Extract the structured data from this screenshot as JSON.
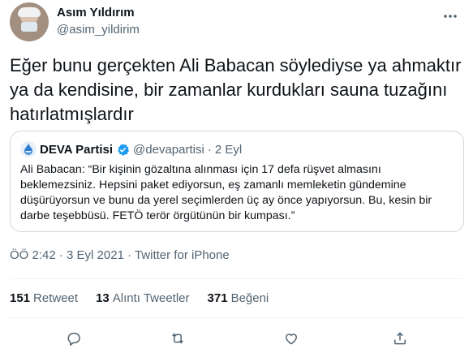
{
  "author": {
    "name": "Asım Yıldırım",
    "handle": "@asim_yildirim"
  },
  "tweet": {
    "text": "Eğer bunu gerçekten Ali Babacan söylediyse ya ahmaktır ya da kendisine, bir zamanlar kurdukları sauna tuzağını hatırlatmışlardır"
  },
  "quoted": {
    "name": "DEVA Partisi",
    "handle": "@devapartisi",
    "dot": "·",
    "date": "2 Eyl",
    "text": "Ali Babacan: “Bir kişinin gözaltına alınması için 17 defa rüşvet almasını beklemezsiniz. Hepsini paket ediyorsun, eş zamanlı memleketin gündemine düşürüyorsun ve bunu da yerel seçimlerden üç ay önce yapıyorsun. Bu, kesin bir darbe teşebbüsü. FETÖ terör örgütünün bir kumpası.”"
  },
  "meta": {
    "timestamp": "ÖÖ 2:42 · 3 Eyl 2021 · Twitter for iPhone"
  },
  "stats": {
    "retweets_count": "151",
    "retweets_label": "Retweet",
    "quotes_count": "13",
    "quotes_label": "Alıntı Tweetler",
    "likes_count": "371",
    "likes_label": "Beğeni"
  },
  "icons": {
    "more": "more-horizontal-icon",
    "reply": "reply-icon",
    "retweet": "retweet-icon",
    "like": "heart-icon",
    "share": "share-icon",
    "verified": "verified-badge-icon"
  },
  "colors": {
    "text_primary": "#0f1419",
    "text_secondary": "#536471",
    "verified": "#1d9bf0",
    "border": "#cfd9de"
  }
}
